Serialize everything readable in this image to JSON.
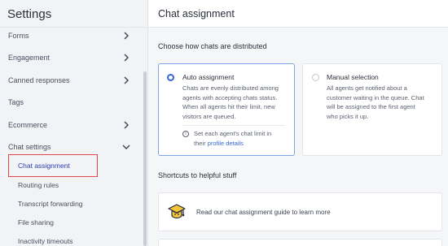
{
  "sidebar": {
    "title": "Settings",
    "items": [
      {
        "label": "Forms"
      },
      {
        "label": "Engagement"
      },
      {
        "label": "Canned responses"
      },
      {
        "label": "Tags"
      },
      {
        "label": "Ecommerce"
      },
      {
        "label": "Chat settings"
      }
    ],
    "sub_items": [
      {
        "label": "Chat assignment",
        "active": true
      },
      {
        "label": "Routing rules"
      },
      {
        "label": "Transcript forwarding"
      },
      {
        "label": "File sharing"
      },
      {
        "label": "Inactivity timeouts"
      }
    ]
  },
  "main": {
    "title": "Chat assignment",
    "distribution_heading": "Choose how chats are distributed",
    "auto": {
      "title": "Auto assignment",
      "desc": [
        "Chats are evenly distributed among",
        "agents with accepting chats status.",
        "When all agents hit their limit, new",
        "visitors are queued."
      ],
      "info_line1": "Set each agent's chat limit in",
      "info_line2_prefix": "their ",
      "info_link": "profile details",
      "selected": true
    },
    "manual": {
      "title": "Manual selection",
      "desc": [
        "All agents get notified about a",
        "customer waiting in the queue. Chat",
        "will be assigned to the first agent",
        "who picks it up."
      ],
      "selected": false
    },
    "shortcuts_heading": "Shortcuts to helpful stuff",
    "guide_text": "Read our chat assignment guide to learn more"
  },
  "colors": {
    "accent": "#3468d8",
    "highlight_border": "#e04848",
    "sidebar_bg": "#f2f3f6"
  }
}
